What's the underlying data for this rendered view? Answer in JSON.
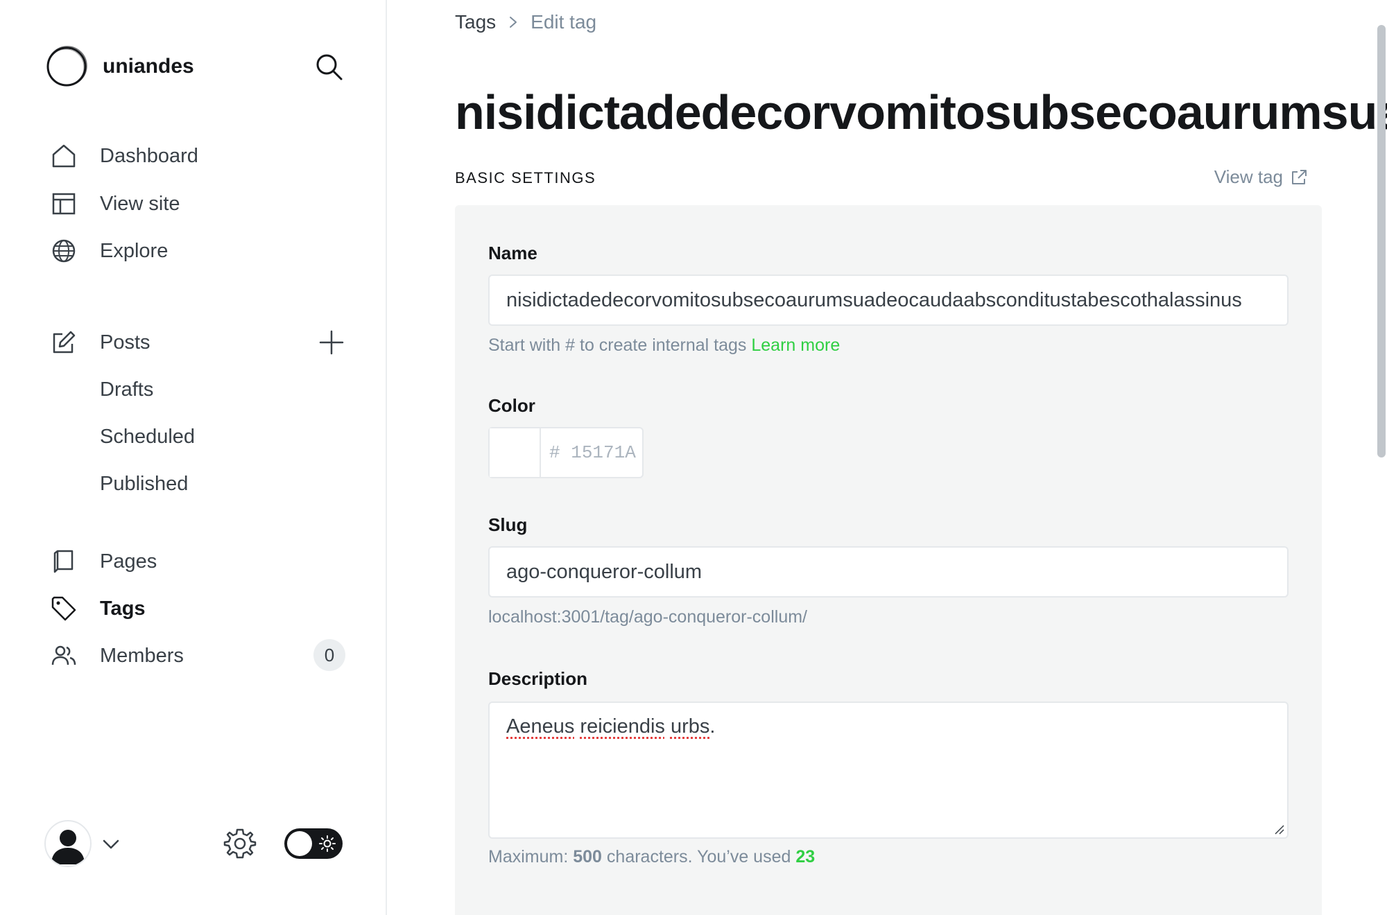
{
  "sidebar": {
    "brand_name": "uniandes",
    "nav": {
      "dashboard": "Dashboard",
      "view_site": "View site",
      "explore": "Explore",
      "posts": "Posts",
      "drafts": "Drafts",
      "scheduled": "Scheduled",
      "published": "Published",
      "pages": "Pages",
      "tags": "Tags",
      "members": "Members"
    },
    "members_count": "0",
    "active_item": "Tags"
  },
  "breadcrumb": {
    "parent": "Tags",
    "current": "Edit tag"
  },
  "page_title": "nisidictadedecorvomitosubsecoaurumsuadeocaudaabsconditustabescothalassinus",
  "section": {
    "title": "BASIC SETTINGS",
    "view_tag": "View tag"
  },
  "form": {
    "name_label": "Name",
    "name_value": "nisidictadedecorvomitosubsecoaurumsuadeocaudaabsconditustabescothalassinus",
    "name_hint": "Start with # to create internal tags",
    "name_hint_link": "Learn more",
    "color_label": "Color",
    "color_hash": "#",
    "color_value": "15171A",
    "slug_label": "Slug",
    "slug_value": "ago-conqueror-collum",
    "slug_url": "localhost:3001/tag/ago-conqueror-collum/",
    "description_label": "Description",
    "description_word1": "Aeneus",
    "description_word2": "reiciendis",
    "description_word3": "urbs",
    "description_end": ".",
    "counter_prefix": "Maximum:",
    "counter_max": "500",
    "counter_middle": "characters. You’ve used",
    "counter_used": "23"
  },
  "colors": {
    "accent_green": "#30cf43",
    "text_dark": "#15171a",
    "muted": "#7c8b9a"
  },
  "icons": [
    "search-icon",
    "home-icon",
    "view-site-icon",
    "globe-icon",
    "edit-icon",
    "plus-icon",
    "pages-icon",
    "tag-icon",
    "members-icon",
    "avatar-icon",
    "chevron-down-icon",
    "gear-icon",
    "sun-icon",
    "external-link-icon",
    "chevron-right-icon"
  ]
}
